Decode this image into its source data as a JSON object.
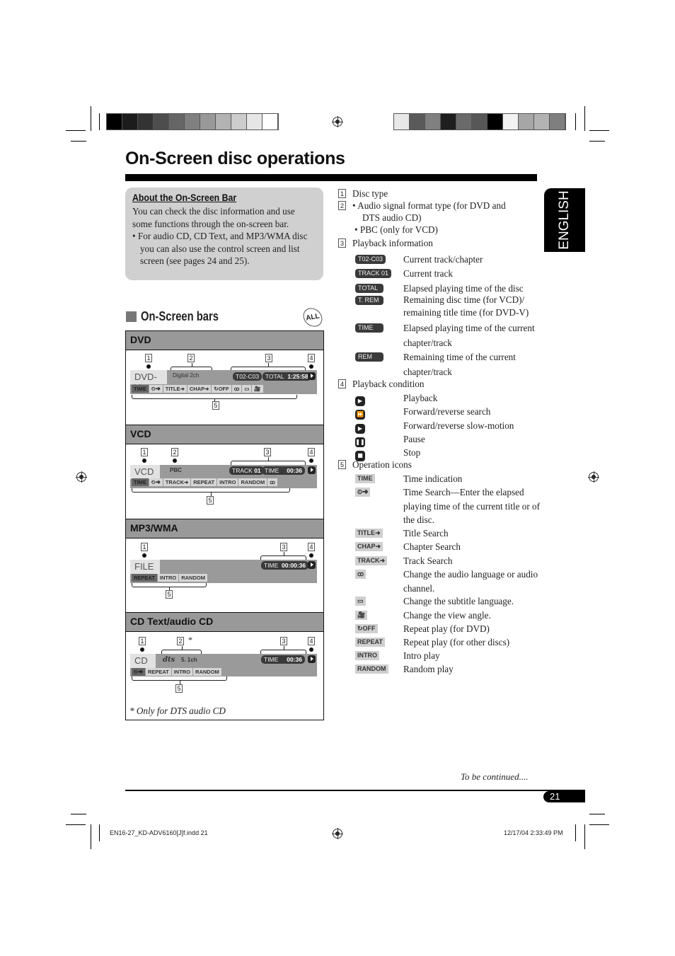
{
  "page": {
    "title": "On-Screen disc operations",
    "language_tab": "ENGLISH",
    "to_be_continued": "To be continued....",
    "page_number": "21",
    "footer_file": "EN16-27_KD-ADV6160[J]f.indd   21",
    "footer_date": "12/17/04   2:33:49 PM"
  },
  "calibration": {
    "left_swatches": [
      "#000000",
      "#1c1c1c",
      "#333333",
      "#4d4d4d",
      "#666666",
      "#808080",
      "#999999",
      "#b3b3b3",
      "#cccccc",
      "#e6e6e6",
      "#ffffff"
    ],
    "right_swatches": [
      "#e8e8e8",
      "#5a5a5a",
      "#808080",
      "#1e1e1e",
      "#6a6a6a",
      "#575757",
      "#000000",
      "#f2f2f2",
      "#a6a6a6",
      "#b3b3b3",
      "#7f7f7f"
    ]
  },
  "about": {
    "heading": "About the On-Screen Bar",
    "text": "You can check the disc information and use some functions through the on-screen bar.",
    "bullet": "• For audio CD, CD Text, and MP3/WMA disc you can also use the control screen and list screen (see pages 24 and 25)."
  },
  "onscreen": {
    "heading": "On-Screen bars",
    "all_icon": "ALL"
  },
  "panels": {
    "dvd": {
      "title": "DVD",
      "disc": "DVD-V",
      "audio": "Digital 2ch",
      "pill1": "T02-C03",
      "pill2_label": "TOTAL",
      "pill2_value": "1:25:58",
      "ops": [
        "TIME",
        "⏲➜",
        "TITLE➜",
        "CHAP➜",
        "↻OFF",
        "ꝏ",
        "▭",
        "🎥"
      ]
    },
    "vcd": {
      "title": "VCD",
      "disc": "VCD",
      "pbc": "PBC",
      "pill1_label": "TRACK",
      "pill1_value": "01",
      "pill2_label": "TIME",
      "pill2_value": "00:36",
      "ops": [
        "TIME",
        "⏲➜",
        "TRACK➜",
        "REPEAT",
        "INTRO",
        "RANDOM",
        "ꝏ"
      ]
    },
    "mp3": {
      "title": "MP3/WMA",
      "disc": "FILE",
      "pill_label": "TIME",
      "pill_value": "00:00:36",
      "ops": [
        "REPEAT",
        "INTRO",
        "RANDOM"
      ]
    },
    "cd": {
      "title": "CD Text/audio CD",
      "disc": "CD",
      "audio_logo": "dts",
      "audio": "5. 1ch",
      "asterisk": "*",
      "pill_label": "TIME",
      "pill_value": "00:36",
      "ops": [
        "⏲➜",
        "REPEAT",
        "INTRO",
        "RANDOM"
      ],
      "note": "* Only for DTS audio CD"
    }
  },
  "legend": {
    "n1": {
      "num": "1",
      "text": "Disc type"
    },
    "n2": {
      "num": "2",
      "bullet1": "• Audio signal format type (for DVD and",
      "bullet1b": "DTS audio CD)",
      "bullet2": "• PBC (only for VCD)"
    },
    "n3": {
      "num": "3",
      "text": "Playback information",
      "items": [
        {
          "icon": "T02-C03",
          "text": "Current track/chapter"
        },
        {
          "icon": "TRACK 01",
          "text": "Current track"
        },
        {
          "icon": "TOTAL",
          "text": "Elapsed playing time of the disc"
        },
        {
          "icon": "T. REM",
          "text": "Remaining disc time (for VCD)/ remaining title time (for DVD-V)"
        },
        {
          "icon": "TIME",
          "text": "Elapsed playing time of the current chapter/track"
        },
        {
          "icon": "REM",
          "text": "Remaining time of the current chapter/track"
        }
      ]
    },
    "n4": {
      "num": "4",
      "text": "Playback condition",
      "items": [
        {
          "icon": "play",
          "text": "Playback"
        },
        {
          "icon": "ff/rew",
          "text": "Forward/reverse search"
        },
        {
          "icon": "slow",
          "text": "Forward/reverse slow-motion"
        },
        {
          "icon": "pause",
          "text": "Pause"
        },
        {
          "icon": "stop",
          "text": "Stop"
        }
      ]
    },
    "n5": {
      "num": "5",
      "text": "Operation icons",
      "items": [
        {
          "icon": "TIME",
          "text": "Time indication"
        },
        {
          "icon": "⏲➜",
          "text": "Time Search—Enter the elapsed playing time of the current title or of the disc."
        },
        {
          "icon": "TITLE➜",
          "text": "Title Search"
        },
        {
          "icon": "CHAP➜",
          "text": "Chapter Search"
        },
        {
          "icon": "TRACK➜",
          "text": "Track Search"
        },
        {
          "icon": "ꝏ",
          "text": "Change the audio language or audio channel."
        },
        {
          "icon": "▭",
          "text": "Change the subtitle language."
        },
        {
          "icon": "🎥",
          "text": "Change the view angle."
        },
        {
          "icon": "↻OFF",
          "text": "Repeat play (for DVD)"
        },
        {
          "icon": "REPEAT",
          "text": "Repeat play (for other discs)"
        },
        {
          "icon": "INTRO",
          "text": "Intro play"
        },
        {
          "icon": "RANDOM",
          "text": "Random play"
        }
      ]
    }
  }
}
